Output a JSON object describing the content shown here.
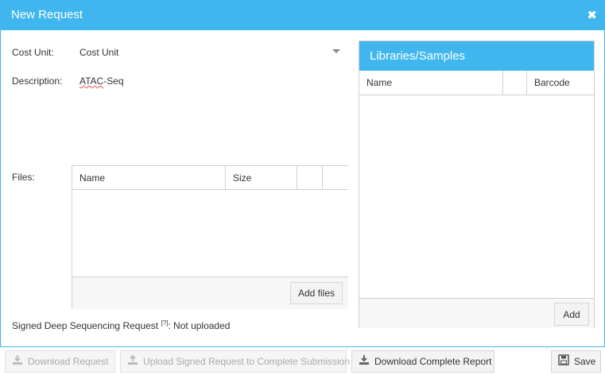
{
  "dialog": {
    "title": "New Request",
    "close_glyph": "✖"
  },
  "form": {
    "cost_unit_label": "Cost Unit:",
    "cost_unit_value": "Cost Unit",
    "description_label": "Description:",
    "description_value_underlined": "ATAC",
    "description_value_rest": "-Seq",
    "files_label": "Files:"
  },
  "files_grid": {
    "columns": [
      "Name",
      "Size",
      "",
      ""
    ],
    "rows": [],
    "add_files_label": "Add files"
  },
  "libraries": {
    "title": "Libraries/Samples",
    "columns": [
      "Name",
      "",
      "Barcode"
    ],
    "rows": [],
    "add_label": "Add"
  },
  "signed": {
    "label": "Signed Deep Sequencing Request",
    "help_marker": "[?]",
    "status": ": Not uploaded"
  },
  "toolbar": {
    "download_request": "Download Request",
    "upload_signed": "Upload Signed Request to Complete Submission",
    "download_report": "Download Complete Report",
    "save": "Save"
  },
  "icons": {
    "download": "download-icon",
    "upload": "upload-icon",
    "save": "floppy-disk-icon",
    "close": "close-icon",
    "dropdown": "chevron-down-icon"
  },
  "colors": {
    "accent": "#3fb7ee",
    "border": "#d0d0d0",
    "disabled_text": "#aaaaaa"
  }
}
